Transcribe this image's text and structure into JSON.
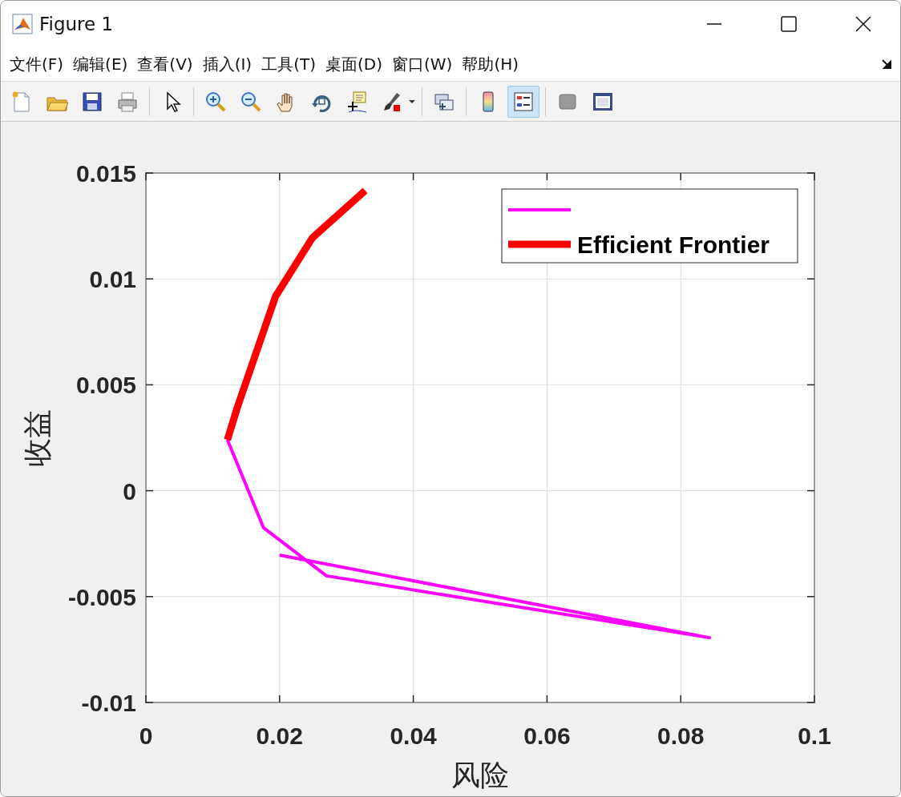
{
  "window": {
    "title": "Figure 1"
  },
  "menu": [
    {
      "label": "文件(F)"
    },
    {
      "label": "编辑(E)"
    },
    {
      "label": "查看(V)"
    },
    {
      "label": "插入(I)"
    },
    {
      "label": "工具(T)"
    },
    {
      "label": "桌面(D)"
    },
    {
      "label": "窗口(W)"
    },
    {
      "label": "帮助(H)"
    }
  ],
  "toolbar": [
    {
      "kind": "new",
      "selected": false
    },
    {
      "kind": "open",
      "selected": false
    },
    {
      "kind": "save",
      "selected": false
    },
    {
      "kind": "print",
      "selected": false
    },
    {
      "kind": "separator"
    },
    {
      "kind": "pointer",
      "selected": false
    },
    {
      "kind": "separator"
    },
    {
      "kind": "zoomin",
      "selected": false
    },
    {
      "kind": "zoomout",
      "selected": false
    },
    {
      "kind": "pan",
      "selected": false
    },
    {
      "kind": "rotate",
      "selected": false
    },
    {
      "kind": "datatip",
      "selected": false
    },
    {
      "kind": "brush",
      "selected": false
    },
    {
      "kind": "separator"
    },
    {
      "kind": "link",
      "selected": false
    },
    {
      "kind": "separator"
    },
    {
      "kind": "colorbar",
      "selected": false
    },
    {
      "kind": "legend",
      "selected": true
    },
    {
      "kind": "separator"
    },
    {
      "kind": "hidetools",
      "selected": false
    },
    {
      "kind": "showtools",
      "selected": false
    }
  ],
  "plot": {
    "chart_data": {
      "type": "line",
      "xlabel": "风险",
      "ylabel": "收益",
      "xlim": [
        0,
        0.1
      ],
      "ylim": [
        -0.01,
        0.015
      ],
      "xticks": [
        0,
        0.02,
        0.04,
        0.06,
        0.08,
        0.1
      ],
      "yticks": [
        -0.01,
        -0.005,
        0,
        0.005,
        0.01,
        0.015
      ],
      "grid": true,
      "series": [
        {
          "color": "#ff00ff",
          "x": [
            0.0122,
            0.0176,
            0.027,
            0.0843,
            0.02
          ],
          "values": [
            0.0024,
            -0.00175,
            -0.00402,
            -0.00694,
            -0.00304
          ]
        },
        {
          "name": "Efficient Frontier",
          "color": "#ff0000",
          "x": [
            0.0122,
            0.0137,
            0.0194,
            0.0249,
            0.0328
          ],
          "values": [
            0.0024,
            0.00396,
            0.00918,
            0.01194,
            0.01417
          ]
        }
      ]
    }
  }
}
